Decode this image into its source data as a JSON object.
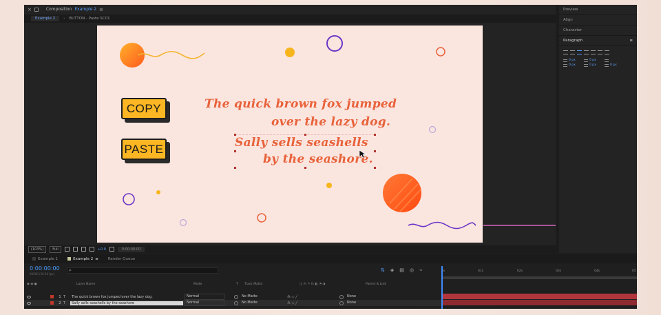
{
  "comp_header": {
    "x": "×",
    "title": "Composition",
    "comp_name": "Example 2",
    "menu": "≡"
  },
  "breadcrumbs": {
    "active": "Example 2",
    "arrow": "›",
    "path": "BUTTON - Paste SC01"
  },
  "stage": {
    "copy_label": "COPY",
    "paste_label": "PASTE",
    "line1": "The quick brown fox jumped",
    "line2": "over the lazy dog.",
    "line3": "Sally sells seashells",
    "line4": "by the seashore.",
    "colors": {
      "background": "#fbe5df",
      "text": "#e8623a",
      "button": "#fbb623",
      "accent_purple": "#6a35c6"
    }
  },
  "comp_footer": {
    "zoom": "(103%)",
    "resolution": "Full",
    "timecode": "0:00:00:00",
    "exposure": "+0.0"
  },
  "right_panel": {
    "items": [
      "Preview",
      "Align",
      "Character"
    ],
    "paragraph_title": "Paragraph",
    "paragraph_menu": "≡",
    "values": [
      "0 px",
      "0 px",
      "0 px",
      "0 px",
      "0 px"
    ]
  },
  "timeline": {
    "tabs": [
      {
        "label": "Example 1"
      },
      {
        "label": "Example 2"
      },
      {
        "label": "Render Queue"
      }
    ],
    "tab_menu": "≡",
    "timecode": "0:00:00:00",
    "timecode_sub": "00000 (30.00 fps)",
    "search_placeholder": "ρ.",
    "ruler": [
      "0s",
      "01s",
      "02s",
      "03s",
      "04s",
      "05"
    ],
    "columns": {
      "layer_name": "Layer Name",
      "mode": "Mode",
      "t": "T",
      "track_matte": "Track Matte",
      "parent": "Parent & Link"
    },
    "layers": [
      {
        "num": "1",
        "type": "T",
        "name": "The quick brown fox jumped  over the lazy dog.",
        "mode": "Normal",
        "matte": "No Matte",
        "parent": "None"
      },
      {
        "num": "2",
        "type": "T",
        "name": "Sally sells seashells  by  the seashore",
        "mode": "Normal",
        "matte": "No Matte",
        "parent": "None"
      }
    ]
  }
}
